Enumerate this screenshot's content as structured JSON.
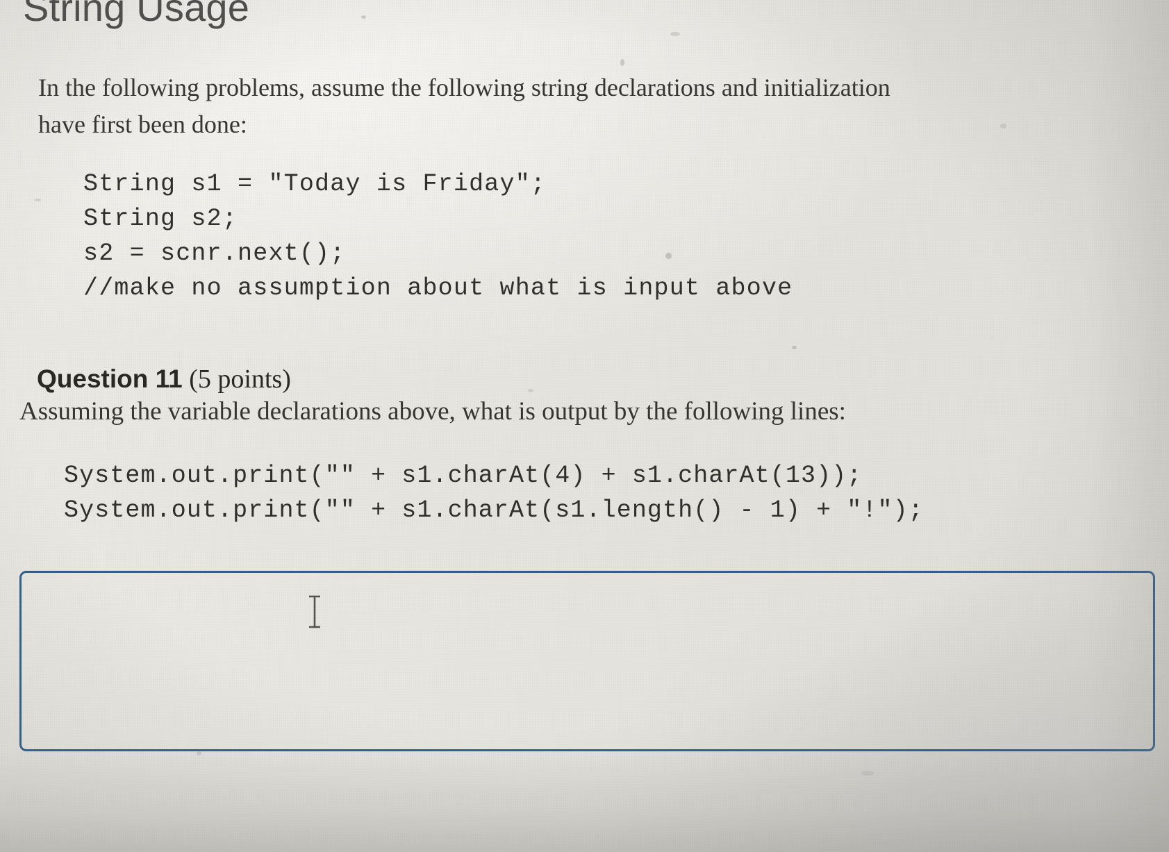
{
  "document": {
    "heading": "String Usage",
    "intro_paragraph": "In the following problems, assume the following string declarations and initialization\nhave first been done:",
    "declarations_code": "String s1 = \"Today is Friday\";\nString s2;\ns2 = scnr.next();\n//make no assumption about what is input above",
    "question_number": "Question 11",
    "question_points": " (5 points)",
    "question_prompt": "Assuming the variable declarations above, what is output by the following lines:",
    "output_code": "System.out.print(\"\" + s1.charAt(4) + s1.charAt(13));\nSystem.out.print(\"\" + s1.charAt(s1.length() - 1) + \"!\");",
    "answer_box": {
      "value": "",
      "placeholder": "",
      "border_color": "#2f5d8c"
    },
    "cursor_icon": "text-cursor-icon"
  }
}
